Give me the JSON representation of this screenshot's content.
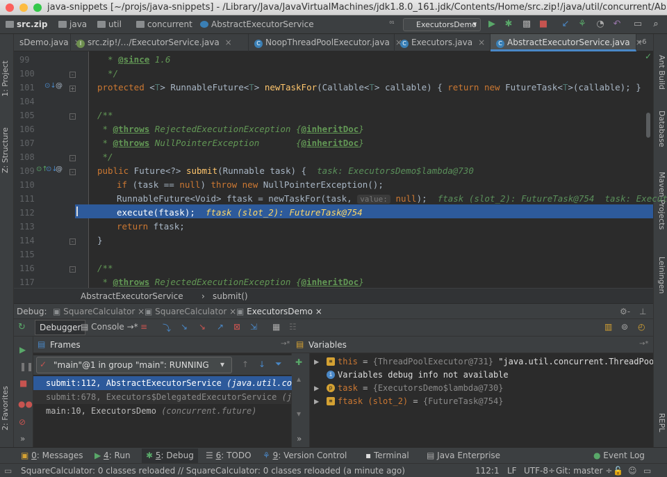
{
  "window": {
    "title": "java-snippets [~/projs/java-snippets] - /Library/Java/JavaVirtualMachines/jdk1.8.0_161.jdk/Contents/Home/src.zip!/java/util/concurrent/Abstr..."
  },
  "breadcrumbs": [
    "src.zip",
    "java",
    "util",
    "concurrent",
    "AbstractExecutorService"
  ],
  "run_config": "ExecutorsDemo",
  "left_tabs": [
    "1: Project",
    "Z: Structure",
    "2: Favorites"
  ],
  "right_tabs": [
    "Ant Build",
    "Database",
    "Maven Projects",
    "Leiningen",
    "REPL"
  ],
  "editor_tabs": [
    {
      "label": "sDemo.java"
    },
    {
      "label": "src.zip!/…/ExecutorService.java"
    },
    {
      "label": "NoopThreadPoolExecutor.java"
    },
    {
      "label": "Executors.java"
    },
    {
      "label": "AbstractExecutorService.java"
    }
  ],
  "tab_overflow": "»6",
  "line_numbers": [
    "99",
    "100",
    "101",
    "104",
    "105",
    "106",
    "107",
    "108",
    "109",
    "110",
    "111",
    "112",
    "113",
    "114",
    "115",
    "116",
    "117"
  ],
  "code": {
    "l99_pre": "  * ",
    "l99_tag": "@since",
    "l99_rest": " 1.6",
    "l100": "  */",
    "l101_kw": "protected",
    "l101_a": " <",
    "l101_t": "T",
    "l101_b": "> RunnableFuture<",
    "l101_t2": "T",
    "l101_c": "> ",
    "l101_fn": "newTaskFor",
    "l101_d": "(Callable<",
    "l101_t3": "T",
    "l101_e": "> callable) { ",
    "l101_kw2": "return new",
    "l101_f": " FutureTask<",
    "l101_t4": "T",
    "l101_g": ">(callable); }",
    "l105": "/**",
    "l106_pre": " * ",
    "l106_tag": "@throws",
    "l106_rest": " RejectedExecutionException {",
    "l106_tag2": "@inheritDoc",
    "l106_end": "}",
    "l107_pre": " * ",
    "l107_tag": "@throws",
    "l107_rest": " NullPointerException       {",
    "l107_tag2": "@inheritDoc",
    "l107_end": "}",
    "l108": " */",
    "l109_kw": "public",
    "l109_a": " Future<?> ",
    "l109_fn": "submit",
    "l109_b": "(Runnable task) {  ",
    "l109_hint": "task: ExecutorsDemo$lambda@730",
    "l110_kw": "if",
    "l110_a": " (task == ",
    "l110_kw2": "null",
    "l110_b": ") ",
    "l110_kw3": "throw new",
    "l110_c": " NullPointerException();",
    "l111_a": "RunnableFuture<Void> ftask = newTaskFor(task, ",
    "l111_param": "value:",
    "l111_kw": " null",
    "l111_b": ");  ",
    "l111_hint": "ftask (slot_2): FutureTask@754  task: ExecutorsDem",
    "l112_a": "execute(ftask);  ",
    "l112_hint": "ftask (slot_2): FutureTask@754",
    "l113_kw": "return",
    "l113_a": " ftask;",
    "l114": "}",
    "l116": "/**",
    "l117_pre": " * ",
    "l117_tag": "@throws",
    "l117_rest": " RejectedExecutionException {",
    "l117_tag2": "@inheritDoc",
    "l117_end": "}"
  },
  "editor_breadcrumb": [
    "AbstractExecutorService",
    "submit()"
  ],
  "debug": {
    "label": "Debug:",
    "sessions": [
      "SquareCalculator",
      "SquareCalculator",
      "ExecutorsDemo"
    ],
    "tabs": [
      "Debugger",
      "Console"
    ],
    "frames_title": "Frames",
    "variables_title": "Variables",
    "thread": "\"main\"@1 in group \"main\": RUNNING",
    "frames": [
      {
        "method": "submit:112, AbstractExecutorService",
        "pkg": "(java.util.concurrent)"
      },
      {
        "method": "submit:678, Executors$DelegatedExecutorService",
        "pkg": "(java.util.c"
      },
      {
        "method": "main:10, ExecutorsDemo",
        "pkg": "(concurrent.future)"
      }
    ],
    "variables": [
      {
        "name": "this",
        "eq": " = ",
        "type": "{ThreadPoolExecutor@731}",
        "value": " \"java.util.concurrent.ThreadPoolExecutor@97e"
      },
      {
        "info": "Variables debug info not available"
      },
      {
        "name": "task",
        "eq": " = ",
        "type": "{ExecutorsDemo$lambda@730}"
      },
      {
        "name": "ftask (slot_2)",
        "eq": " = ",
        "type": "{FutureTask@754}"
      }
    ]
  },
  "tool_windows": [
    {
      "key": "0",
      "label": ": Messages"
    },
    {
      "key": "4",
      "label": ": Run"
    },
    {
      "key": "5",
      "label": ": Debug"
    },
    {
      "key": "6",
      "label": ": TODO"
    },
    {
      "key": "9",
      "label": ": Version Control"
    },
    {
      "key": "",
      "label": "Terminal"
    },
    {
      "key": "",
      "label": "Java Enterprise"
    },
    {
      "key": "",
      "label": "Event Log"
    }
  ],
  "status": {
    "message": "SquareCalculator: 0 classes reloaded // SquareCalculator: 0 classes reloaded (a minute ago)",
    "position": "112:1",
    "line_sep": "LF",
    "encoding": "UTF-8÷",
    "git": "Git: master ÷"
  },
  "colors": {
    "accent": "#4a88c7",
    "selection": "#2d5a9b",
    "keyword": "#cc7832",
    "string": "#6a8759"
  }
}
